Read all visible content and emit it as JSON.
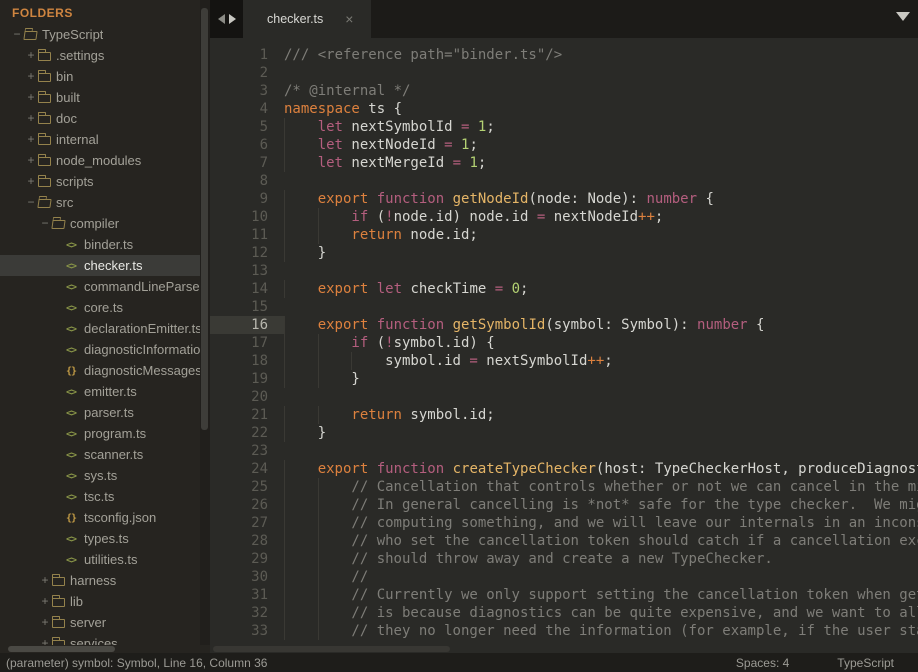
{
  "colors": {
    "editorBg": "#2a2a27",
    "sidebarBg": "#262420",
    "tabbarBg": "#1c1b18",
    "arrowBoxBg": "#141311",
    "statusBg": "#1e1d1a",
    "scrollTrack": "#211f1c",
    "scrollThumb": "#3e3d39",
    "scrollThumbLight": "#4a4944",
    "scrollThumbDim": "#383733",
    "headerOrange": "#cf8540",
    "sidebarText": "#a3a198",
    "selRowBg": "#3b3b38",
    "selRowText": "#e8e8e4",
    "expanderGray": "#7c7b74",
    "folderLine": "#94824c",
    "codeIconGreen": "#879347",
    "jsonIconOrange": "#c09a45",
    "tabText": "#d8d8d4",
    "tabCloseGray": "#7a7a74",
    "arrowDim": "#8b8b85",
    "arrowLit": "#c9c8c2",
    "gutterText": "#5c5b54",
    "activeGutterBg": "#3a3a35",
    "activeGutterText": "#b8b7ae",
    "indentGuide": "#3a3934",
    "plain": "#d6d6d1",
    "comment": "#7e7d78",
    "pink": "#b45e7e",
    "orange": "#dd813e",
    "funcYellow": "#e5b567",
    "numGreen": "#b4d273",
    "statusText": "#9c9b95"
  },
  "sidebar": {
    "header": "FOLDERS",
    "tree": [
      {
        "label": "TypeScript",
        "icon": "folder-open",
        "exp": "−",
        "level": 0,
        "selected": false
      },
      {
        "label": ".settings",
        "icon": "folder",
        "exp": "+",
        "level": 1,
        "selected": false
      },
      {
        "label": "bin",
        "icon": "folder",
        "exp": "+",
        "level": 1,
        "selected": false
      },
      {
        "label": "built",
        "icon": "folder",
        "exp": "+",
        "level": 1,
        "selected": false
      },
      {
        "label": "doc",
        "icon": "folder",
        "exp": "+",
        "level": 1,
        "selected": false
      },
      {
        "label": "internal",
        "icon": "folder",
        "exp": "+",
        "level": 1,
        "selected": false
      },
      {
        "label": "node_modules",
        "icon": "folder",
        "exp": "+",
        "level": 1,
        "selected": false
      },
      {
        "label": "scripts",
        "icon": "folder",
        "exp": "+",
        "level": 1,
        "selected": false
      },
      {
        "label": "src",
        "icon": "folder-open",
        "exp": "−",
        "level": 1,
        "selected": false
      },
      {
        "label": "compiler",
        "icon": "folder-open",
        "exp": "−",
        "level": 2,
        "selected": false
      },
      {
        "label": "binder.ts",
        "icon": "code",
        "exp": "",
        "level": 3,
        "selected": false
      },
      {
        "label": "checker.ts",
        "icon": "code",
        "exp": "",
        "level": 3,
        "selected": true
      },
      {
        "label": "commandLineParser.ts",
        "icon": "code",
        "exp": "",
        "level": 3,
        "selected": false
      },
      {
        "label": "core.ts",
        "icon": "code",
        "exp": "",
        "level": 3,
        "selected": false
      },
      {
        "label": "declarationEmitter.ts",
        "icon": "code",
        "exp": "",
        "level": 3,
        "selected": false
      },
      {
        "label": "diagnosticInformationMap.generated.ts",
        "icon": "code",
        "exp": "",
        "level": 3,
        "selected": false
      },
      {
        "label": "diagnosticMessages.json",
        "icon": "json",
        "exp": "",
        "level": 3,
        "selected": false
      },
      {
        "label": "emitter.ts",
        "icon": "code",
        "exp": "",
        "level": 3,
        "selected": false
      },
      {
        "label": "parser.ts",
        "icon": "code",
        "exp": "",
        "level": 3,
        "selected": false
      },
      {
        "label": "program.ts",
        "icon": "code",
        "exp": "",
        "level": 3,
        "selected": false
      },
      {
        "label": "scanner.ts",
        "icon": "code",
        "exp": "",
        "level": 3,
        "selected": false
      },
      {
        "label": "sys.ts",
        "icon": "code",
        "exp": "",
        "level": 3,
        "selected": false
      },
      {
        "label": "tsc.ts",
        "icon": "code",
        "exp": "",
        "level": 3,
        "selected": false
      },
      {
        "label": "tsconfig.json",
        "icon": "json",
        "exp": "",
        "level": 3,
        "selected": false
      },
      {
        "label": "types.ts",
        "icon": "code",
        "exp": "",
        "level": 3,
        "selected": false
      },
      {
        "label": "utilities.ts",
        "icon": "code",
        "exp": "",
        "level": 3,
        "selected": false
      },
      {
        "label": "harness",
        "icon": "folder",
        "exp": "+",
        "level": 2,
        "selected": false
      },
      {
        "label": "lib",
        "icon": "folder",
        "exp": "+",
        "level": 2,
        "selected": false
      },
      {
        "label": "server",
        "icon": "folder",
        "exp": "+",
        "level": 2,
        "selected": false
      },
      {
        "label": "services",
        "icon": "folder",
        "exp": "+",
        "level": 2,
        "selected": false
      }
    ]
  },
  "tabbar": {
    "tabs": [
      {
        "label": "checker.ts",
        "close": "×"
      }
    ]
  },
  "editor": {
    "active_line": 16,
    "lines": [
      {
        "num": 1,
        "tokens": [
          [
            "c",
            "/// <reference path=\"binder.ts\"/>"
          ]
        ]
      },
      {
        "num": 2,
        "tokens": []
      },
      {
        "num": 3,
        "tokens": [
          [
            "c",
            "/* @internal */"
          ]
        ]
      },
      {
        "num": 4,
        "tokens": [
          [
            "o",
            "namespace"
          ],
          [
            "p",
            " ts {"
          ]
        ]
      },
      {
        "num": 5,
        "tokens": [
          [
            "p",
            "    "
          ],
          [
            "k",
            "let"
          ],
          [
            "p",
            " nextSymbolId "
          ],
          [
            "k",
            "="
          ],
          [
            "p",
            " "
          ],
          [
            "n",
            "1"
          ],
          [
            "p",
            ";"
          ]
        ]
      },
      {
        "num": 6,
        "tokens": [
          [
            "p",
            "    "
          ],
          [
            "k",
            "let"
          ],
          [
            "p",
            " nextNodeId "
          ],
          [
            "k",
            "="
          ],
          [
            "p",
            " "
          ],
          [
            "n",
            "1"
          ],
          [
            "p",
            ";"
          ]
        ]
      },
      {
        "num": 7,
        "tokens": [
          [
            "p",
            "    "
          ],
          [
            "k",
            "let"
          ],
          [
            "p",
            " nextMergeId "
          ],
          [
            "k",
            "="
          ],
          [
            "p",
            " "
          ],
          [
            "n",
            "1"
          ],
          [
            "p",
            ";"
          ]
        ]
      },
      {
        "num": 8,
        "tokens": []
      },
      {
        "num": 9,
        "tokens": [
          [
            "p",
            "    "
          ],
          [
            "o",
            "export"
          ],
          [
            "p",
            " "
          ],
          [
            "k",
            "function"
          ],
          [
            "p",
            " "
          ],
          [
            "f",
            "getNodeId"
          ],
          [
            "p",
            "(node: Node): "
          ],
          [
            "k",
            "number"
          ],
          [
            "p",
            " {"
          ]
        ]
      },
      {
        "num": 10,
        "tokens": [
          [
            "p",
            "        "
          ],
          [
            "k",
            "if"
          ],
          [
            "p",
            " ("
          ],
          [
            "k",
            "!"
          ],
          [
            "p",
            "node.id) node.id "
          ],
          [
            "k",
            "="
          ],
          [
            "p",
            " nextNodeId"
          ],
          [
            "o",
            "++"
          ],
          [
            "p",
            ";"
          ]
        ]
      },
      {
        "num": 11,
        "tokens": [
          [
            "p",
            "        "
          ],
          [
            "o",
            "return"
          ],
          [
            "p",
            " node.id;"
          ]
        ]
      },
      {
        "num": 12,
        "tokens": [
          [
            "p",
            "    }"
          ]
        ]
      },
      {
        "num": 13,
        "tokens": []
      },
      {
        "num": 14,
        "tokens": [
          [
            "p",
            "    "
          ],
          [
            "o",
            "export"
          ],
          [
            "p",
            " "
          ],
          [
            "k",
            "let"
          ],
          [
            "p",
            " checkTime "
          ],
          [
            "k",
            "="
          ],
          [
            "p",
            " "
          ],
          [
            "n",
            "0"
          ],
          [
            "p",
            ";"
          ]
        ]
      },
      {
        "num": 15,
        "tokens": []
      },
      {
        "num": 16,
        "tokens": [
          [
            "p",
            "    "
          ],
          [
            "o",
            "export"
          ],
          [
            "p",
            " "
          ],
          [
            "k",
            "function"
          ],
          [
            "p",
            " "
          ],
          [
            "f",
            "getSymbolId"
          ],
          [
            "p",
            "(symbol: Symbol): "
          ],
          [
            "k",
            "number"
          ],
          [
            "p",
            " {"
          ]
        ]
      },
      {
        "num": 17,
        "tokens": [
          [
            "p",
            "        "
          ],
          [
            "k",
            "if"
          ],
          [
            "p",
            " ("
          ],
          [
            "k",
            "!"
          ],
          [
            "p",
            "symbol.id) {"
          ]
        ]
      },
      {
        "num": 18,
        "tokens": [
          [
            "p",
            "            symbol.id "
          ],
          [
            "k",
            "="
          ],
          [
            "p",
            " nextSymbolId"
          ],
          [
            "o",
            "++"
          ],
          [
            "p",
            ";"
          ]
        ]
      },
      {
        "num": 19,
        "tokens": [
          [
            "p",
            "        }"
          ]
        ]
      },
      {
        "num": 20,
        "tokens": []
      },
      {
        "num": 21,
        "tokens": [
          [
            "p",
            "        "
          ],
          [
            "o",
            "return"
          ],
          [
            "p",
            " symbol.id;"
          ]
        ]
      },
      {
        "num": 22,
        "tokens": [
          [
            "p",
            "    }"
          ]
        ]
      },
      {
        "num": 23,
        "tokens": []
      },
      {
        "num": 24,
        "tokens": [
          [
            "p",
            "    "
          ],
          [
            "o",
            "export"
          ],
          [
            "p",
            " "
          ],
          [
            "k",
            "function"
          ],
          [
            "p",
            " "
          ],
          [
            "f",
            "createTypeChecker"
          ],
          [
            "p",
            "(host: TypeCheckerHost, produceDiagnostics: boolean): TypeChecker {"
          ]
        ]
      },
      {
        "num": 25,
        "tokens": [
          [
            "p",
            "        "
          ],
          [
            "c",
            "// Cancellation that controls whether or not we can cancel in the middle of type checking."
          ]
        ]
      },
      {
        "num": 26,
        "tokens": [
          [
            "p",
            "        "
          ],
          [
            "c",
            "// In general cancelling is *not* safe for the type checker.  We might be in the middle of"
          ]
        ]
      },
      {
        "num": 27,
        "tokens": [
          [
            "p",
            "        "
          ],
          [
            "c",
            "// computing something, and we will leave our internals in an inconsistent state.  Callers"
          ]
        ]
      },
      {
        "num": 28,
        "tokens": [
          [
            "p",
            "        "
          ],
          [
            "c",
            "// who set the cancellation token should catch if a cancellation exception occurs, and"
          ]
        ]
      },
      {
        "num": 29,
        "tokens": [
          [
            "p",
            "        "
          ],
          [
            "c",
            "// should throw away and create a new TypeChecker."
          ]
        ]
      },
      {
        "num": 30,
        "tokens": [
          [
            "p",
            "        "
          ],
          [
            "c",
            "//"
          ]
        ]
      },
      {
        "num": 31,
        "tokens": [
          [
            "p",
            "        "
          ],
          [
            "c",
            "// Currently we only support setting the cancellation token when getting diagnostics.  This"
          ]
        ]
      },
      {
        "num": 32,
        "tokens": [
          [
            "p",
            "        "
          ],
          [
            "c",
            "// is because diagnostics can be quite expensive, and we want to allow hosts to bail out when"
          ]
        ]
      },
      {
        "num": 33,
        "tokens": [
          [
            "p",
            "        "
          ],
          [
            "c",
            "// they no longer need the information (for example, if the user started editing again)."
          ]
        ]
      }
    ]
  },
  "statusbar": {
    "left": "(parameter) symbol: Symbol, Line 16, Column 36",
    "spaces": "Spaces: 4",
    "syntax": "TypeScript"
  }
}
